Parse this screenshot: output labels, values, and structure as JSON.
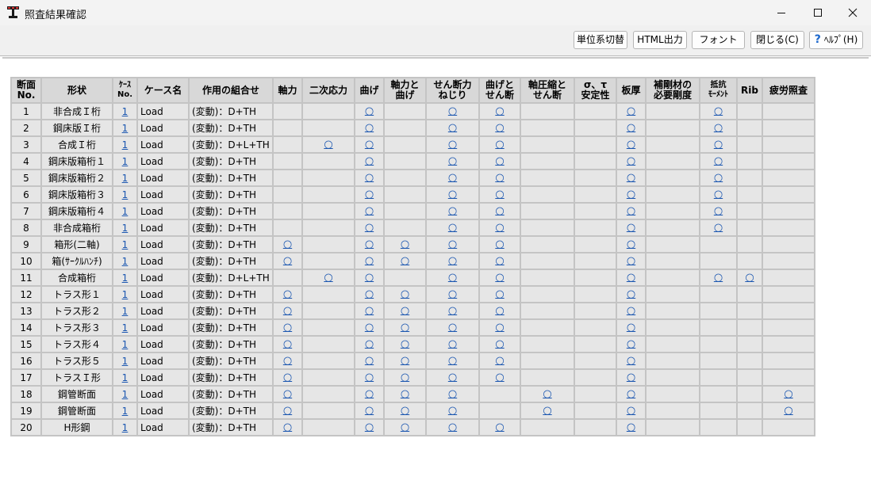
{
  "window": {
    "title": "照査結果確認",
    "controls": [
      "minimize-icon",
      "maximize-icon",
      "close-icon"
    ]
  },
  "toolbar": {
    "unit_label": "単位系切替",
    "html_label": "HTML出力",
    "font_label": "フォント",
    "close_label": "閉じる(C)",
    "help_label": "ﾍﾙﾌﾟ(H)",
    "help_icon": "help-icon"
  },
  "table": {
    "headers": [
      [
        "断面",
        "No."
      ],
      [
        "形状"
      ],
      [
        "ｹｰｽ",
        "No."
      ],
      [
        "ケース名"
      ],
      [
        "作用の組合せ"
      ],
      [
        "軸力"
      ],
      [
        "二次応力"
      ],
      [
        "曲げ"
      ],
      [
        "軸力と",
        "曲げ"
      ],
      [
        "せん断力",
        "ねじり"
      ],
      [
        "曲げと",
        "せん断"
      ],
      [
        "軸圧縮と",
        "せん断"
      ],
      [
        "σ、τ",
        "安定性"
      ],
      [
        "板厚"
      ],
      [
        "補剛材の",
        "必要剛度"
      ],
      [
        "抵抗",
        "ﾓｰﾒﾝﾄ"
      ],
      [
        "Rib"
      ],
      [
        "疲労照査"
      ]
    ],
    "mark": "○",
    "rows": [
      {
        "no": "1",
        "shape": "非合成Ｉ桁",
        "case_no": "1",
        "case_name": "Load",
        "combo": "(変動)：D+TH",
        "checks": [
          "",
          "",
          "○",
          "",
          "○",
          "○",
          "",
          "",
          "○",
          "",
          "○",
          "",
          ""
        ]
      },
      {
        "no": "2",
        "shape": "鋼床版Ｉ桁",
        "case_no": "1",
        "case_name": "Load",
        "combo": "(変動)：D+TH",
        "checks": [
          "",
          "",
          "○",
          "",
          "○",
          "○",
          "",
          "",
          "○",
          "",
          "○",
          "",
          ""
        ]
      },
      {
        "no": "3",
        "shape": "合成Ｉ桁",
        "case_no": "1",
        "case_name": "Load",
        "combo": "(変動)：D+L+TH",
        "checks": [
          "",
          "○",
          "○",
          "",
          "○",
          "○",
          "",
          "",
          "○",
          "",
          "○",
          "",
          ""
        ]
      },
      {
        "no": "4",
        "shape": "鋼床版箱桁１",
        "case_no": "1",
        "case_name": "Load",
        "combo": "(変動)：D+TH",
        "checks": [
          "",
          "",
          "○",
          "",
          "○",
          "○",
          "",
          "",
          "○",
          "",
          "○",
          "",
          ""
        ]
      },
      {
        "no": "5",
        "shape": "鋼床版箱桁２",
        "case_no": "1",
        "case_name": "Load",
        "combo": "(変動)：D+TH",
        "checks": [
          "",
          "",
          "○",
          "",
          "○",
          "○",
          "",
          "",
          "○",
          "",
          "○",
          "",
          ""
        ]
      },
      {
        "no": "6",
        "shape": "鋼床版箱桁３",
        "case_no": "1",
        "case_name": "Load",
        "combo": "(変動)：D+TH",
        "checks": [
          "",
          "",
          "○",
          "",
          "○",
          "○",
          "",
          "",
          "○",
          "",
          "○",
          "",
          ""
        ]
      },
      {
        "no": "7",
        "shape": "鋼床版箱桁４",
        "case_no": "1",
        "case_name": "Load",
        "combo": "(変動)：D+TH",
        "checks": [
          "",
          "",
          "○",
          "",
          "○",
          "○",
          "",
          "",
          "○",
          "",
          "○",
          "",
          ""
        ]
      },
      {
        "no": "8",
        "shape": "非合成箱桁",
        "case_no": "1",
        "case_name": "Load",
        "combo": "(変動)：D+TH",
        "checks": [
          "",
          "",
          "○",
          "",
          "○",
          "○",
          "",
          "",
          "○",
          "",
          "○",
          "",
          ""
        ]
      },
      {
        "no": "9",
        "shape": "箱形(二軸)",
        "case_no": "1",
        "case_name": "Load",
        "combo": "(変動)：D+TH",
        "checks": [
          "○",
          "",
          "○",
          "○",
          "○",
          "○",
          "",
          "",
          "○",
          "",
          "",
          "",
          ""
        ]
      },
      {
        "no": "10",
        "shape": "箱(ｻｰｸﾙﾊﾝﾁ)",
        "case_no": "1",
        "case_name": "Load",
        "combo": "(変動)：D+TH",
        "checks": [
          "○",
          "",
          "○",
          "○",
          "○",
          "○",
          "",
          "",
          "○",
          "",
          "",
          "",
          ""
        ]
      },
      {
        "no": "11",
        "shape": "合成箱桁",
        "case_no": "1",
        "case_name": "Load",
        "combo": "(変動)：D+L+TH",
        "checks": [
          "",
          "○",
          "○",
          "",
          "○",
          "○",
          "",
          "",
          "○",
          "",
          "○",
          "○",
          ""
        ]
      },
      {
        "no": "12",
        "shape": "トラス形１",
        "case_no": "1",
        "case_name": "Load",
        "combo": "(変動)：D+TH",
        "checks": [
          "○",
          "",
          "○",
          "○",
          "○",
          "○",
          "",
          "",
          "○",
          "",
          "",
          "",
          ""
        ]
      },
      {
        "no": "13",
        "shape": "トラス形２",
        "case_no": "1",
        "case_name": "Load",
        "combo": "(変動)：D+TH",
        "checks": [
          "○",
          "",
          "○",
          "○",
          "○",
          "○",
          "",
          "",
          "○",
          "",
          "",
          "",
          ""
        ]
      },
      {
        "no": "14",
        "shape": "トラス形３",
        "case_no": "1",
        "case_name": "Load",
        "combo": "(変動)：D+TH",
        "checks": [
          "○",
          "",
          "○",
          "○",
          "○",
          "○",
          "",
          "",
          "○",
          "",
          "",
          "",
          ""
        ]
      },
      {
        "no": "15",
        "shape": "トラス形４",
        "case_no": "1",
        "case_name": "Load",
        "combo": "(変動)：D+TH",
        "checks": [
          "○",
          "",
          "○",
          "○",
          "○",
          "○",
          "",
          "",
          "○",
          "",
          "",
          "",
          ""
        ]
      },
      {
        "no": "16",
        "shape": "トラス形５",
        "case_no": "1",
        "case_name": "Load",
        "combo": "(変動)：D+TH",
        "checks": [
          "○",
          "",
          "○",
          "○",
          "○",
          "○",
          "",
          "",
          "○",
          "",
          "",
          "",
          ""
        ]
      },
      {
        "no": "17",
        "shape": "トラスＩ形",
        "case_no": "1",
        "case_name": "Load",
        "combo": "(変動)：D+TH",
        "checks": [
          "○",
          "",
          "○",
          "○",
          "○",
          "○",
          "",
          "",
          "○",
          "",
          "",
          "",
          ""
        ]
      },
      {
        "no": "18",
        "shape": "鋼管断面",
        "case_no": "1",
        "case_name": "Load",
        "combo": "(変動)：D+TH",
        "checks": [
          "○",
          "",
          "○",
          "○",
          "○",
          "",
          "○",
          "",
          "○",
          "",
          "",
          "",
          "○"
        ]
      },
      {
        "no": "19",
        "shape": "鋼管断面",
        "case_no": "1",
        "case_name": "Load",
        "combo": "(変動)：D+TH",
        "checks": [
          "○",
          "",
          "○",
          "○",
          "○",
          "",
          "○",
          "",
          "○",
          "",
          "",
          "",
          "○"
        ]
      },
      {
        "no": "20",
        "shape": "H形鋼",
        "case_no": "1",
        "case_name": "Load",
        "combo": "(変動)：D+TH",
        "checks": [
          "○",
          "",
          "○",
          "○",
          "○",
          "○",
          "",
          "",
          "○",
          "",
          "",
          "",
          ""
        ]
      }
    ]
  }
}
